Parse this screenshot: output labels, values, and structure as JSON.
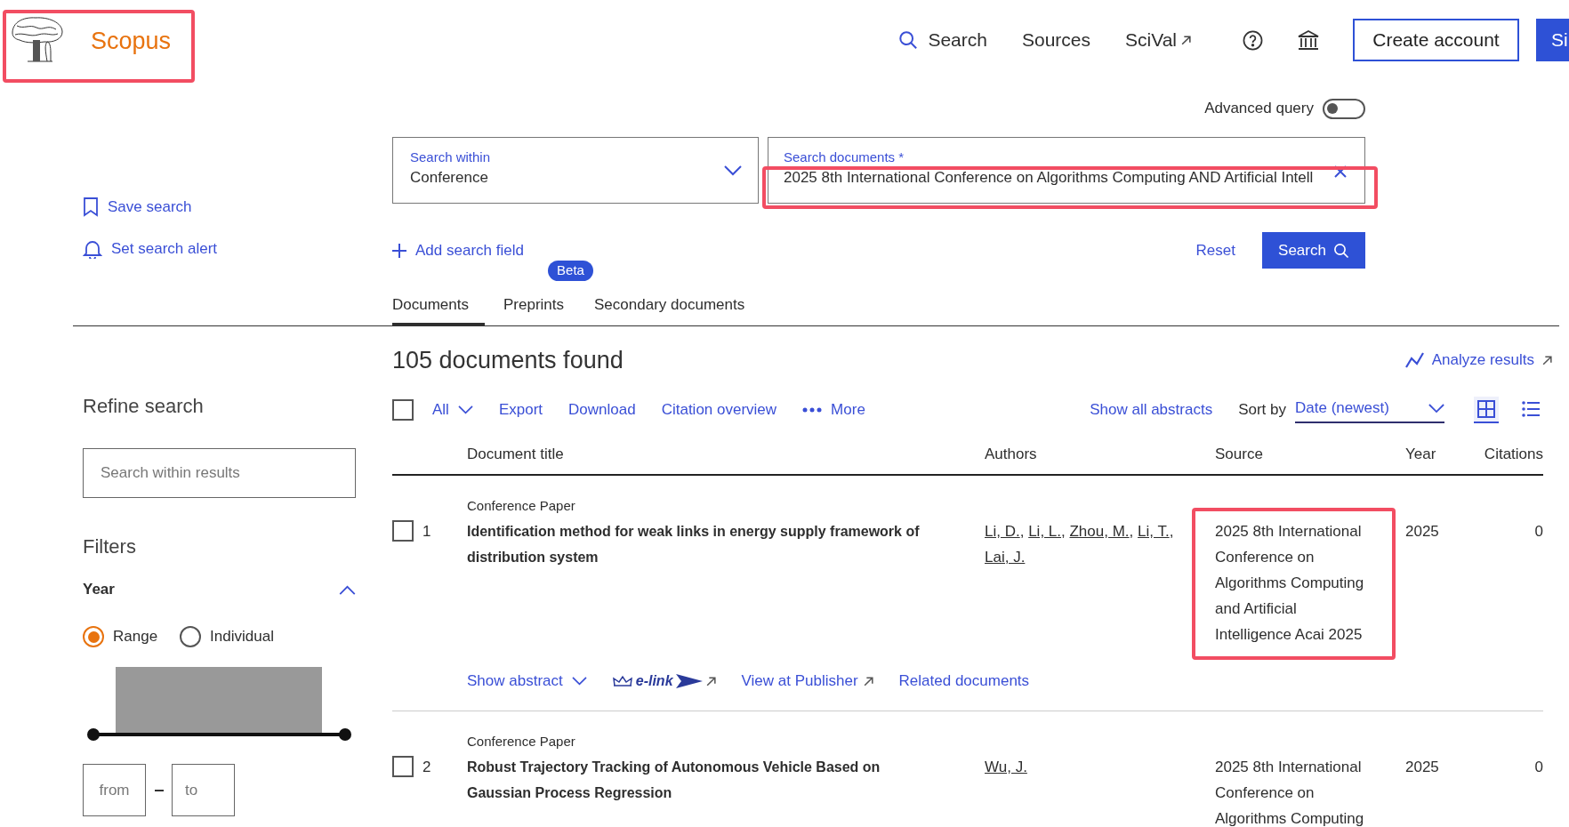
{
  "logo": {
    "text": "Scopus",
    "annotated": true
  },
  "nav": {
    "items": [
      {
        "label": "Search",
        "kind": "search"
      },
      {
        "label": "Sources",
        "kind": "plain"
      },
      {
        "label": "SciVal",
        "kind": "external"
      }
    ],
    "create_account": "Create account",
    "sign_in": "Si"
  },
  "advanced_query": {
    "label": "Advanced query",
    "on": false
  },
  "search_within": {
    "label": "Search within",
    "value": "Conference"
  },
  "search_documents": {
    "label": "Search documents *",
    "value": "2025 8th International Conference on Algorithms Computing AND Artificial Intell",
    "annotated": true
  },
  "side_actions": [
    {
      "label": "Save search",
      "kind": "bookmark"
    },
    {
      "label": "Set search alert",
      "kind": "bell"
    }
  ],
  "add_search_field": "Add search field",
  "reset": "Reset",
  "search_button": "Search",
  "tabs": [
    {
      "label": "Documents",
      "selected": true
    },
    {
      "label": "Preprints",
      "selected": false,
      "badge": "Beta"
    },
    {
      "label": "Secondary documents",
      "selected": false
    }
  ],
  "results": {
    "count": "105 documents found",
    "analyze": "Analyze results"
  },
  "refine": {
    "title": "Refine search",
    "placeholder": "Search within results",
    "filters_title": "Filters",
    "year": {
      "label": "Year",
      "expanded": true,
      "modes": [
        {
          "label": "Range",
          "selected": true
        },
        {
          "label": "Individual",
          "selected": false
        }
      ],
      "from_placeholder": "from",
      "to_placeholder": "to"
    }
  },
  "toolbar": {
    "select_all_checked": false,
    "all": "All",
    "actions": [
      {
        "label": "Export",
        "kind": "plain"
      },
      {
        "label": "Download",
        "kind": "plain"
      },
      {
        "label": "Citation overview",
        "kind": "plain"
      },
      {
        "label": "More",
        "kind": "more"
      }
    ],
    "show_all_abstracts": "Show all abstracts",
    "sort_label": "Sort by",
    "sort_value": "Date (newest)",
    "views": [
      {
        "kind": "grid",
        "selected": true
      },
      {
        "kind": "list",
        "selected": false
      }
    ]
  },
  "table": {
    "columns": [
      "Document title",
      "Authors",
      "Source",
      "Year",
      "Citations"
    ],
    "rows": [
      {
        "checked": false,
        "number": "1",
        "type": "Conference Paper",
        "title": "Identification method for weak links in energy supply framework of distribution system",
        "authors": [
          "Li, D.",
          "Li, L.",
          "Zhou, M.",
          "Li, T.",
          "Lai, J."
        ],
        "author_separators": [
          ",",
          ",",
          ",",
          ","
        ],
        "source": "2025 8th International Conference on Algorithms Computing and Artificial Intelligence Acai 2025",
        "source_annotated": true,
        "year": "2025",
        "citations": "0",
        "links": [
          {
            "label": "Show abstract",
            "kind": "abstract"
          },
          {
            "label": "e-link",
            "kind": "elink"
          },
          {
            "label": "View at Publisher",
            "kind": "external"
          },
          {
            "label": "Related documents",
            "kind": "plain"
          }
        ]
      },
      {
        "checked": false,
        "number": "2",
        "type": "Conference Paper",
        "title": "Robust Trajectory Tracking of Autonomous Vehicle Based on Gaussian Process Regression",
        "authors": [
          "Wu, J."
        ],
        "source": "2025 8th International Conference on Algorithms Computing",
        "source_annotated": false,
        "year": "2025",
        "citations": "0",
        "links": []
      }
    ]
  }
}
